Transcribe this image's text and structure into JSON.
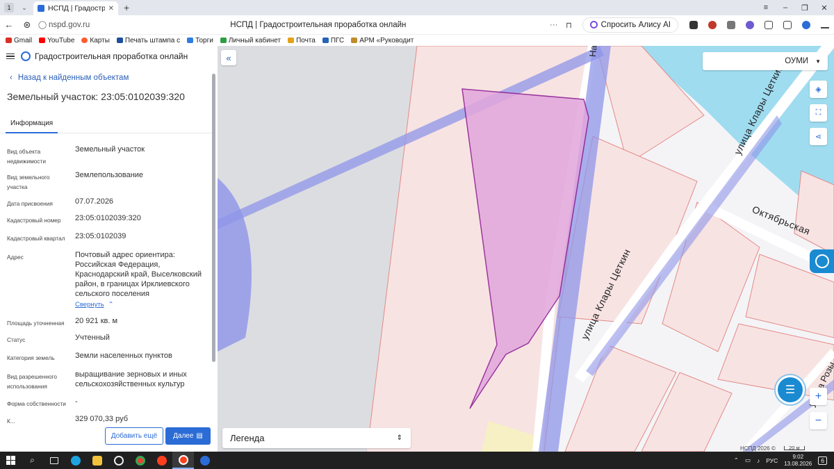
{
  "browser": {
    "tab_counter": "1",
    "tab_title": "НСПД | Градостроите",
    "url": "nspd.gov.ru",
    "page_title": "НСПД | Градостроительная проработка онлайн",
    "alice_label": "Спросить Алису AI"
  },
  "bookmarks": [
    {
      "label": "Gmail",
      "color": "#d93025"
    },
    {
      "label": "YouTube",
      "color": "#ff0000"
    },
    {
      "label": "Карты",
      "color": "#ff5b2e"
    },
    {
      "label": "Печать штампа с",
      "color": "#1f4e9c"
    },
    {
      "label": "Торги",
      "color": "#2f7de1"
    },
    {
      "label": "Личный кабинет",
      "color": "#2e9e44"
    },
    {
      "label": "Почта",
      "color": "#e3a11a"
    },
    {
      "label": "ПГС",
      "color": "#2563b5"
    },
    {
      "label": "АРМ «Руководит",
      "color": "#c08b2c"
    }
  ],
  "app": {
    "title": "Градостроительная проработка онлайн"
  },
  "panel": {
    "back_label": "Назад к найденным объектам",
    "object_title": "Земельный участок: 23:05:0102039:320",
    "tab_label": "Информация",
    "collapse_label": "Свернуть",
    "properties": [
      {
        "label": "Вид объекта недвижимости",
        "value": "Земельный участок"
      },
      {
        "label": "Вид земельного участка",
        "value": "Землепользование"
      },
      {
        "label": "Дата присвоения",
        "value": "07.07.2026"
      },
      {
        "label": "Кадастровый номер",
        "value": "23:05:0102039:320"
      },
      {
        "label": "Кадастровый квартал",
        "value": "23:05:0102039"
      },
      {
        "label": "Адрес",
        "value": "Почтовый адрес ориентира: Российская Федерация, Краснодарский край, Выселковский район, в границах Ирклиевского сельского поселения"
      },
      {
        "label": "Площадь уточненная",
        "value": "20 921 кв. м"
      },
      {
        "label": "Статус",
        "value": "Учтенный"
      },
      {
        "label": "Категория земель",
        "value": "Земли населенных пунктов"
      },
      {
        "label": "Вид разрешенного использования",
        "value": "выращивание зерновых и иных сельскохозяйственных культур"
      },
      {
        "label": "Форма собственности",
        "value": "-"
      },
      {
        "label": "К...",
        "value": "329 070,33 руб"
      }
    ],
    "add_button": "Добавить ещё",
    "next_button": "Далее"
  },
  "map": {
    "layer_select": "ОУМИ",
    "legend_label": "Легенда",
    "attribution": "НСПД 2026 ©",
    "scale_label": "20 м",
    "streets": [
      "улица Клары Цеткин",
      "Октябрьская",
      "улица Клары Цеткин",
      "Набережная",
      "улица Розы"
    ],
    "colors": {
      "parcel_fill": "#f8e3e3",
      "parcel_border": "#e28b86",
      "selected_fill": "#e2a6dc",
      "selected_border": "#8a1a92",
      "road_overlay": "#8f95e8",
      "water": "#9fdcf0",
      "grey_zone": "#dcdde1",
      "accent": "#2b6cd6"
    }
  },
  "taskbar": {
    "language": "РУС",
    "time": "9:02",
    "date": "13.08.2026",
    "notifications": "6"
  }
}
